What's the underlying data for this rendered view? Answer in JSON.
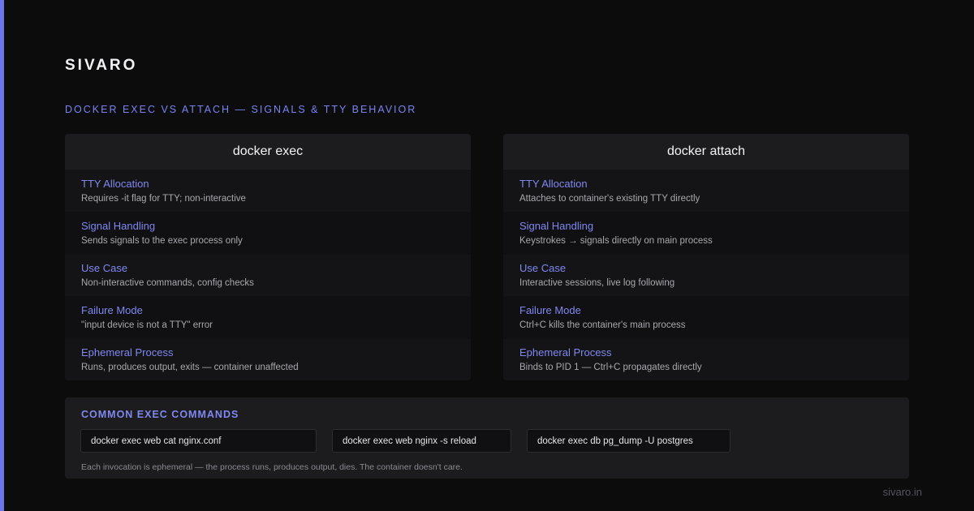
{
  "brand": "SIVARO",
  "subtitle": "DOCKER EXEC VS ATTACH — SIGNALS & TTY BEHAVIOR",
  "colors": {
    "accent": "#6b74e8",
    "label": "#8088f0",
    "background": "#0c0c0d",
    "card": "#1c1c1f"
  },
  "columns": [
    {
      "title": "docker exec",
      "rows": [
        {
          "label": "TTY Allocation",
          "desc": "Requires -it flag for TTY; non-interactive"
        },
        {
          "label": "Signal Handling",
          "desc": "Sends signals to the exec process only"
        },
        {
          "label": "Use Case",
          "desc": "Non-interactive commands, config checks"
        },
        {
          "label": "Failure Mode",
          "desc": "\"input device is not a TTY\" error"
        },
        {
          "label": "Ephemeral Process",
          "desc": "Runs, produces output, exits — container unaffected"
        }
      ]
    },
    {
      "title": "docker attach",
      "rows": [
        {
          "label": "TTY Allocation",
          "desc": "Attaches to container's existing TTY directly"
        },
        {
          "label": "Signal Handling",
          "desc": "Keystrokes → signals directly on main process"
        },
        {
          "label": "Use Case",
          "desc": "Interactive sessions, live log following"
        },
        {
          "label": "Failure Mode",
          "desc": "Ctrl+C kills the container's main process"
        },
        {
          "label": "Ephemeral Process",
          "desc": "Binds to PID 1 — Ctrl+C propagates directly"
        }
      ]
    }
  ],
  "commands_panel": {
    "title": "COMMON EXEC COMMANDS",
    "commands": [
      "docker exec web cat nginx.conf",
      "docker exec web nginx -s reload",
      "docker exec db pg_dump -U postgres"
    ],
    "note": "Each invocation is ephemeral — the process runs, produces output, dies. The container doesn't care."
  },
  "footer": "sivaro.in"
}
